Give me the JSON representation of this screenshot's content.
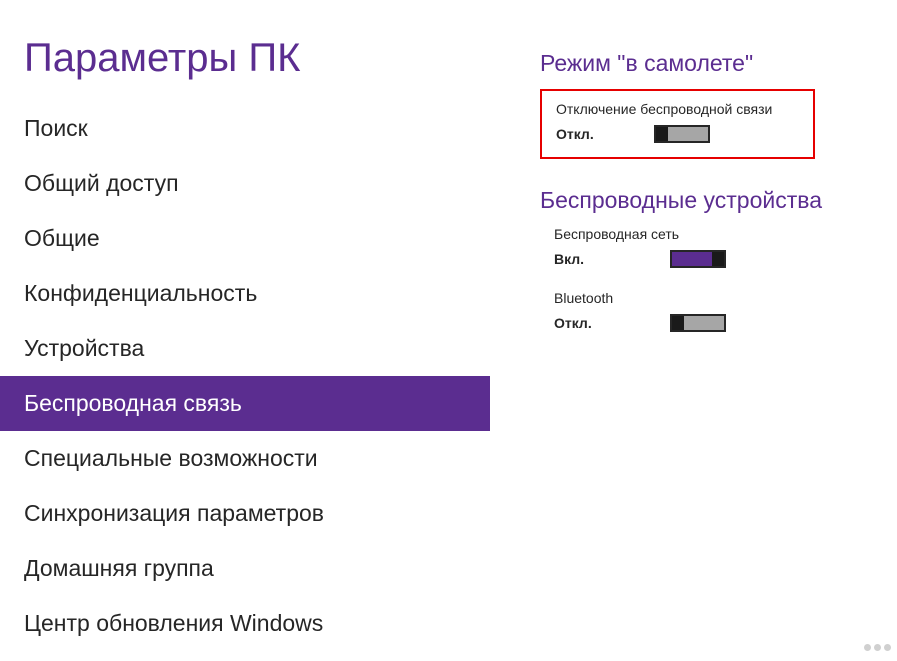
{
  "page_title": "Параметры ПК",
  "sidebar": {
    "items": [
      {
        "label": "Поиск",
        "selected": false
      },
      {
        "label": "Общий доступ",
        "selected": false
      },
      {
        "label": "Общие",
        "selected": false
      },
      {
        "label": "Конфиденциальность",
        "selected": false
      },
      {
        "label": "Устройства",
        "selected": false
      },
      {
        "label": "Беспроводная связь",
        "selected": true
      },
      {
        "label": "Специальные возможности",
        "selected": false
      },
      {
        "label": "Синхронизация параметров",
        "selected": false
      },
      {
        "label": "Домашняя группа",
        "selected": false
      },
      {
        "label": "Центр обновления Windows",
        "selected": false
      }
    ]
  },
  "content": {
    "airplane_mode": {
      "header": "Режим \"в самолете\"",
      "setting_label": "Отключение беспроводной связи",
      "state_label": "Откл.",
      "state_on": false
    },
    "wireless_devices": {
      "header": "Беспроводные устройства",
      "wifi": {
        "label": "Беспроводная сеть",
        "state_label": "Вкл.",
        "state_on": true
      },
      "bluetooth": {
        "label": "Bluetooth",
        "state_label": "Откл.",
        "state_on": false
      }
    }
  },
  "colors": {
    "accent": "#5b2d90",
    "highlight_border": "#e60000"
  }
}
